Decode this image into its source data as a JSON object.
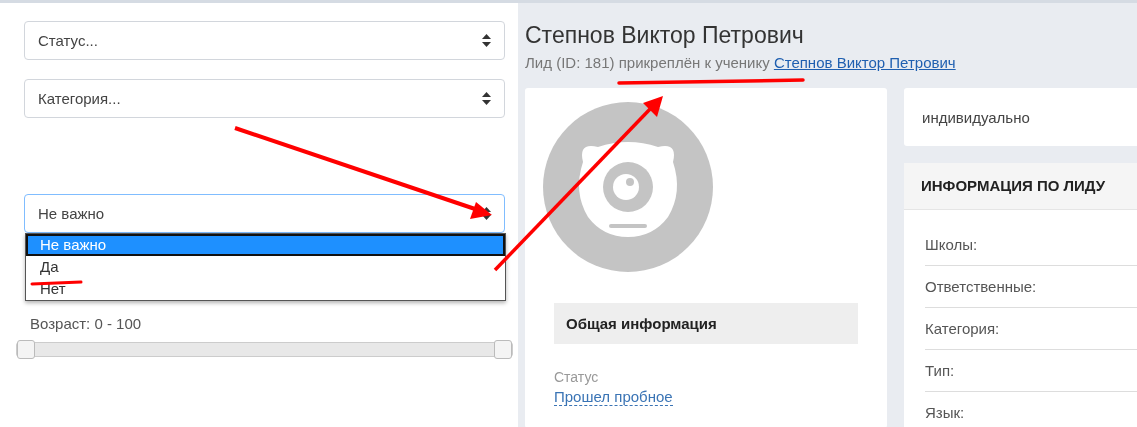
{
  "filters": {
    "selects": [
      {
        "value": "Статус...",
        "expanded": false
      },
      {
        "value": "Категория...",
        "expanded": false
      },
      {
        "value": "Не важно",
        "expanded": true,
        "options": [
          {
            "label": "Не важно",
            "selected": true
          },
          {
            "label": "Да",
            "selected": false
          },
          {
            "label": "Нет",
            "selected": false
          }
        ]
      }
    ],
    "age": {
      "label": "Возраст: 0 - 100",
      "handles": [
        {
          "level": 0
        },
        {
          "level": 1
        }
      ]
    }
  },
  "lead": {
    "title": "Степнов Виктор Петрович",
    "subtitle": "Лид (ID: 181) прикреплён к ученику",
    "student_link": "Степнов Виктор Петрович",
    "general": {
      "heading": "Общая информация",
      "fields": [
        {
          "label": "Статус",
          "value": "Прошел пробное"
        }
      ]
    },
    "type_card": "индивидуально",
    "info": {
      "heading": "ИНФОРМАЦИЯ ПО ЛИДУ",
      "rows": [
        "Школы:",
        "Ответственные:",
        "Категория:",
        "Тип:",
        "Язык:"
      ]
    }
  }
}
